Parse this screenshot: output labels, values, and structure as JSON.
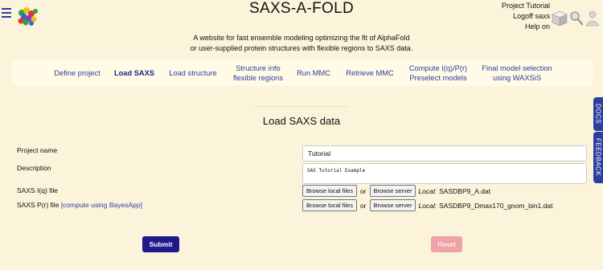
{
  "header": {
    "title": "SAXS-A-FOLD",
    "subtitle_line1": "A website for fast ensemble modeling optimizing the fit of AlphaFold",
    "subtitle_line2": "or user-supplied protein structures with flexible regions to SAXS data.",
    "project": "Project Tutorial",
    "logoff": "Logoff saxs",
    "help": "Help on"
  },
  "nav": [
    {
      "line1": "Define project",
      "line2": ""
    },
    {
      "line1": "Load SAXS",
      "line2": ""
    },
    {
      "line1": "Load structure",
      "line2": ""
    },
    {
      "line1": "Structure info",
      "line2": "flexible regions"
    },
    {
      "line1": "Run MMC",
      "line2": ""
    },
    {
      "line1": "Retrieve MMC",
      "line2": ""
    },
    {
      "line1": "Compute I(q)/P(r)",
      "line2": "Preselect models"
    },
    {
      "line1": "Final model selection",
      "line2": "using WAXSiS"
    }
  ],
  "main": {
    "section_title": "Load SAXS data",
    "project_name_label": "Project name",
    "project_name_value": "Tutorial",
    "description_label": "Description",
    "description_value": "SAS Tutorial Example",
    "iq_label": "SAXS I(q) file",
    "pr_label": "SAXS P(r) file",
    "pr_link": "[compute using BayesApp]",
    "browse_local": "Browse local files",
    "or_text": "or",
    "browse_server": "Browse server",
    "local_label": "Local:",
    "iq_file": "SASDBP9_A.dat",
    "pr_file": "SASDBP9_Dmax170_gnom_bin1.dat",
    "submit": "Submit",
    "reset": "Reset"
  },
  "side_tabs": {
    "docs": "DOCS",
    "feedback": "FEEDBACK"
  },
  "icons": [
    "menu-icon",
    "logo-icon",
    "cube-icon",
    "search-icon",
    "user-icon"
  ],
  "colors": {
    "background": "#fcf3db",
    "nav_link": "#2a3f9f",
    "submit": "#1e1a8c",
    "reset": "#eea3a6",
    "side_tab": "#2a3f9f"
  }
}
